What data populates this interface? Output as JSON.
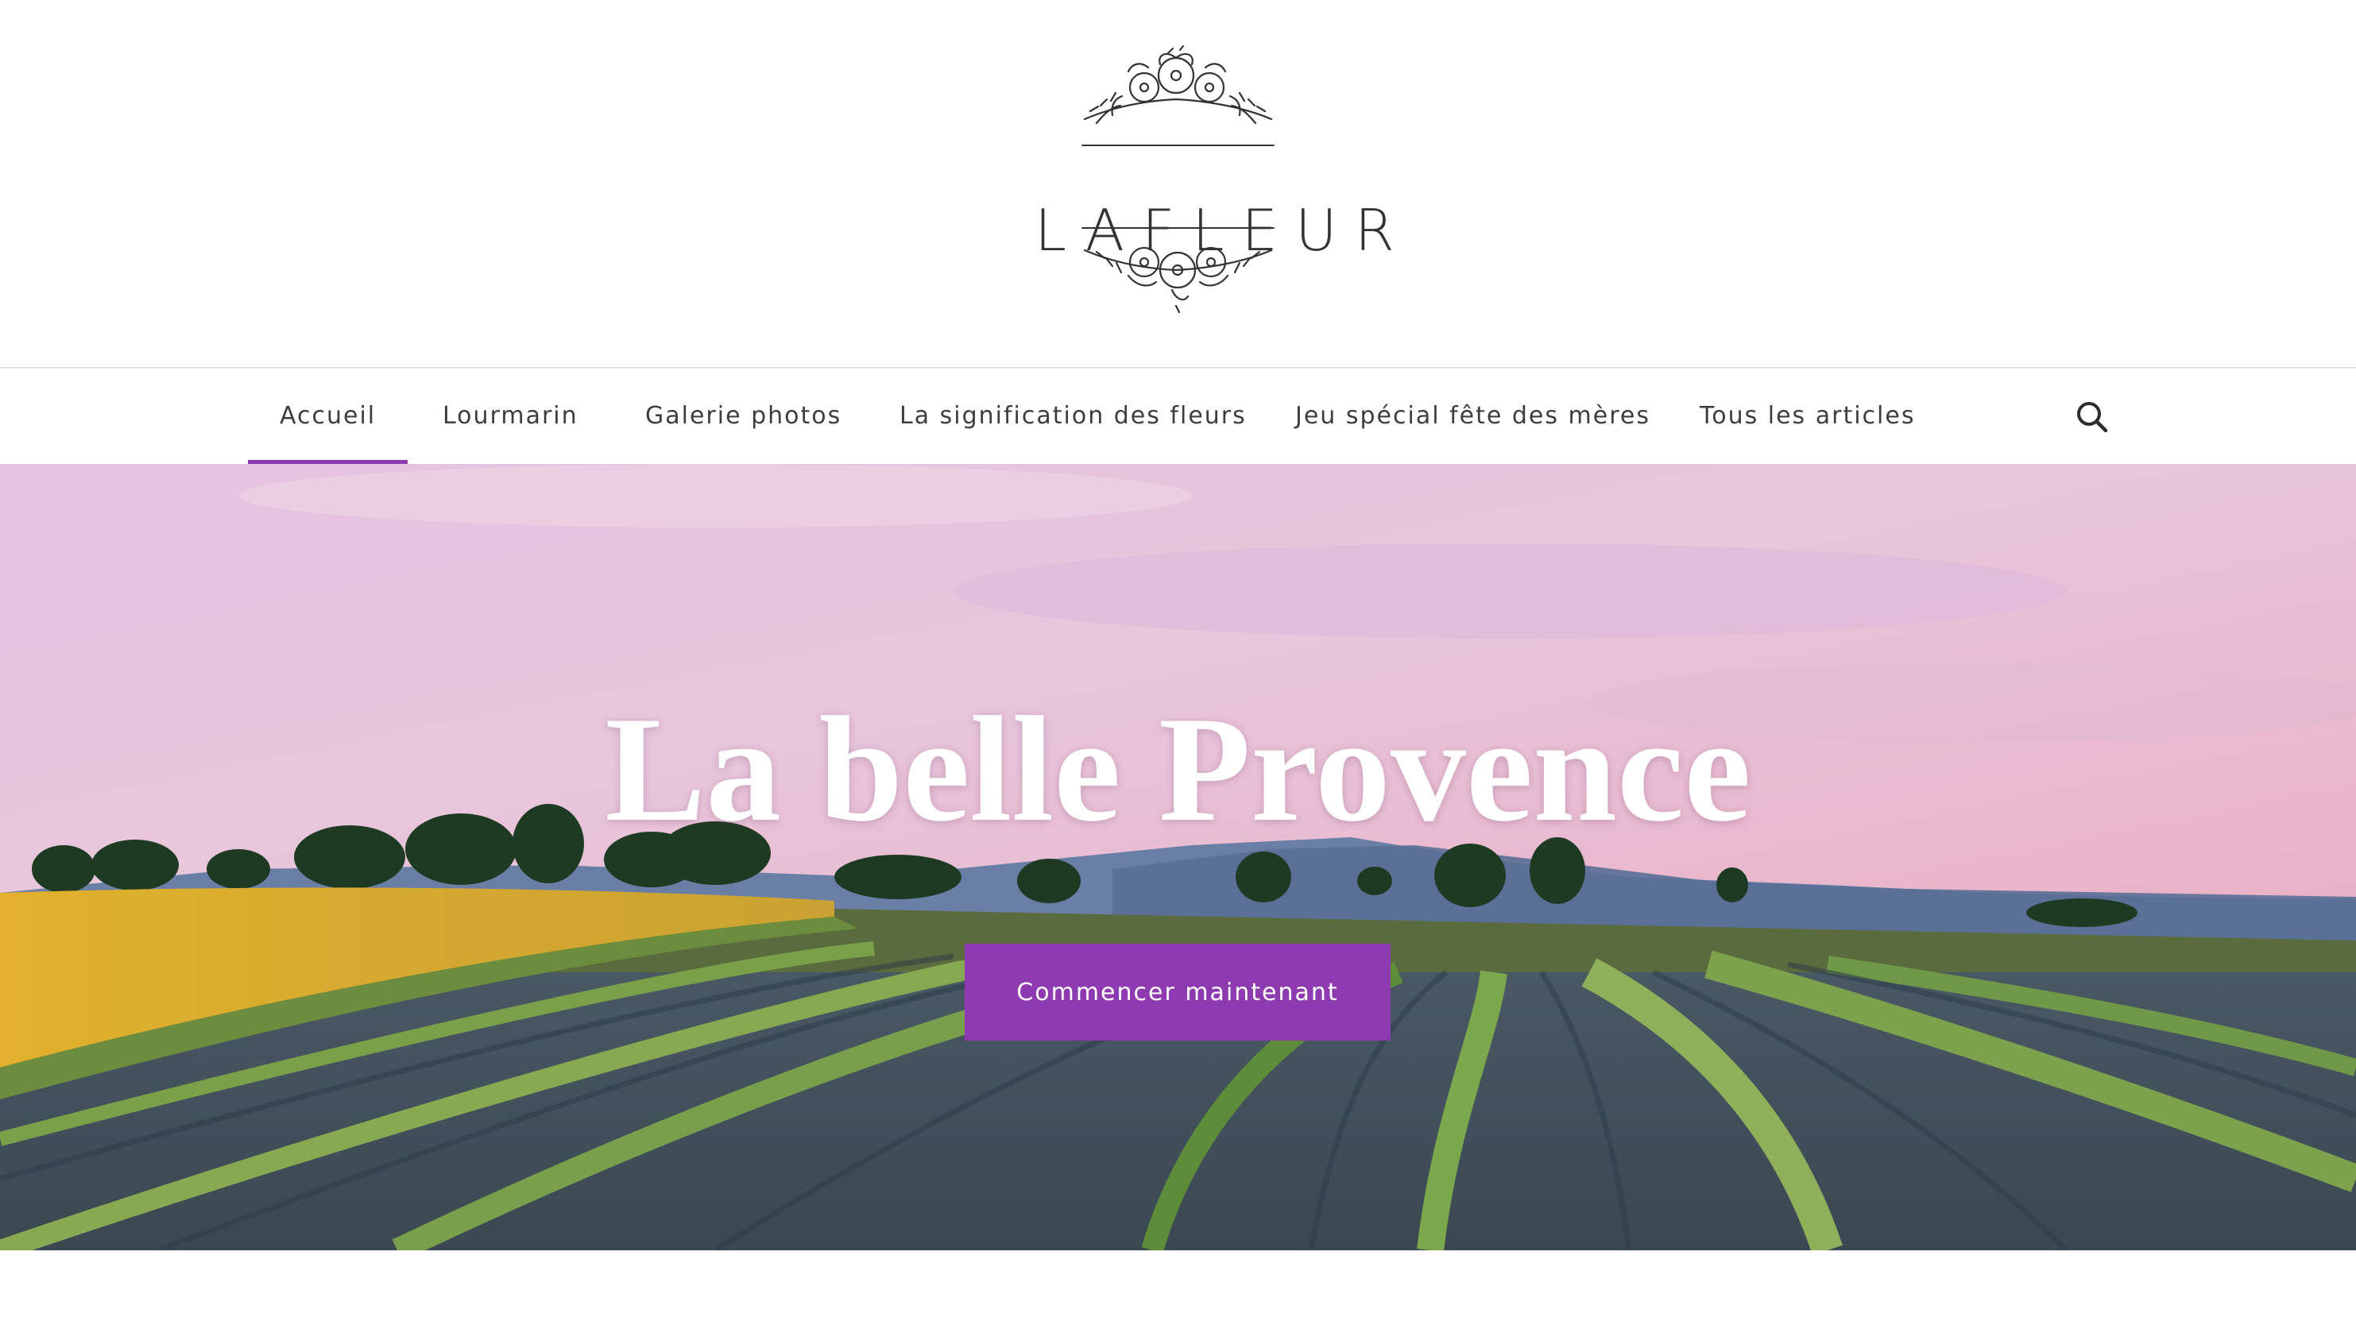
{
  "brand": {
    "name": "LAFLEUR"
  },
  "nav": {
    "items": [
      {
        "label": "Accueil",
        "active": true
      },
      {
        "label": "Lourmarin",
        "active": false
      },
      {
        "label": "Galerie photos",
        "active": false
      },
      {
        "label": "La signification des fleurs",
        "active": false
      },
      {
        "label": "Jeu spécial fête des mères",
        "active": false
      },
      {
        "label": "Tous les articles",
        "active": false
      }
    ],
    "search_icon": "search-icon"
  },
  "hero": {
    "title": "La belle Provence",
    "cta_label": "Commencer maintenant"
  },
  "colors": {
    "accent": "#8e3ab0",
    "nav_text": "#3d3d3d",
    "sky_top": "#e7c4df",
    "sky_bottom": "#e9b4cb"
  }
}
